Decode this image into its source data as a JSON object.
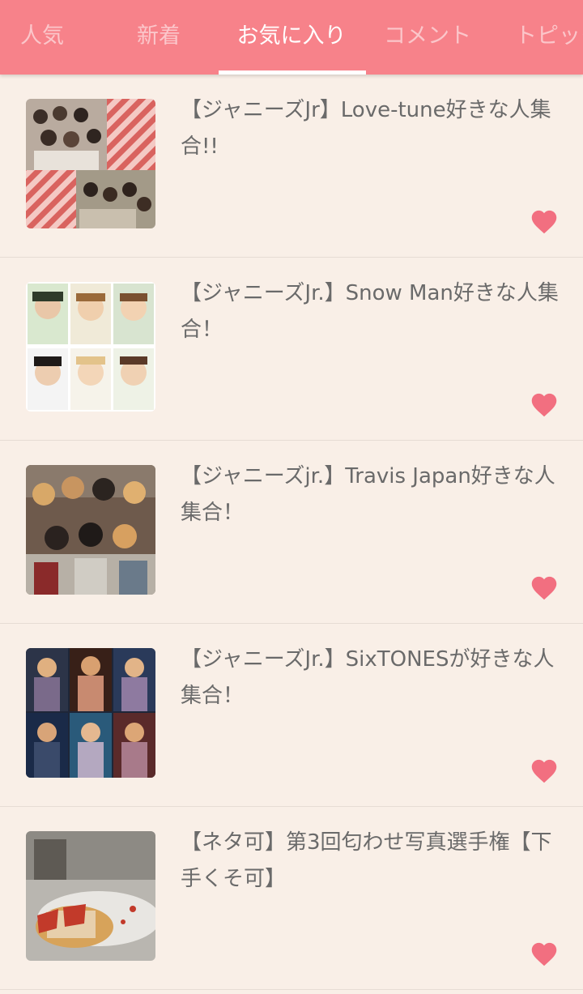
{
  "tabs": [
    {
      "label": "人気",
      "active": false
    },
    {
      "label": "新着",
      "active": false
    },
    {
      "label": "お気に入り",
      "active": true
    },
    {
      "label": "コメント",
      "active": false
    },
    {
      "label": "トピック",
      "active": false
    }
  ],
  "favorites": [
    {
      "title": "【ジャニーズJr】Love-tune好きな人集合!!",
      "favorite_icon": "heart-icon"
    },
    {
      "title": "【ジャニーズJr.】Snow Man好きな人集合！",
      "favorite_icon": "heart-icon"
    },
    {
      "title": "【ジャニーズjr.】Travis Japan好きな人集合！",
      "favorite_icon": "heart-icon"
    },
    {
      "title": "【ジャニーズJr.】SixTONESが好きな人集合！",
      "favorite_icon": "heart-icon"
    },
    {
      "title": "【ネタ可】第3回匂わせ写真選手権【下手くそ可】",
      "favorite_icon": "heart-icon"
    }
  ],
  "colors": {
    "accent": "#f7828a",
    "background": "#f9efe7",
    "heart": "#f26f80"
  }
}
